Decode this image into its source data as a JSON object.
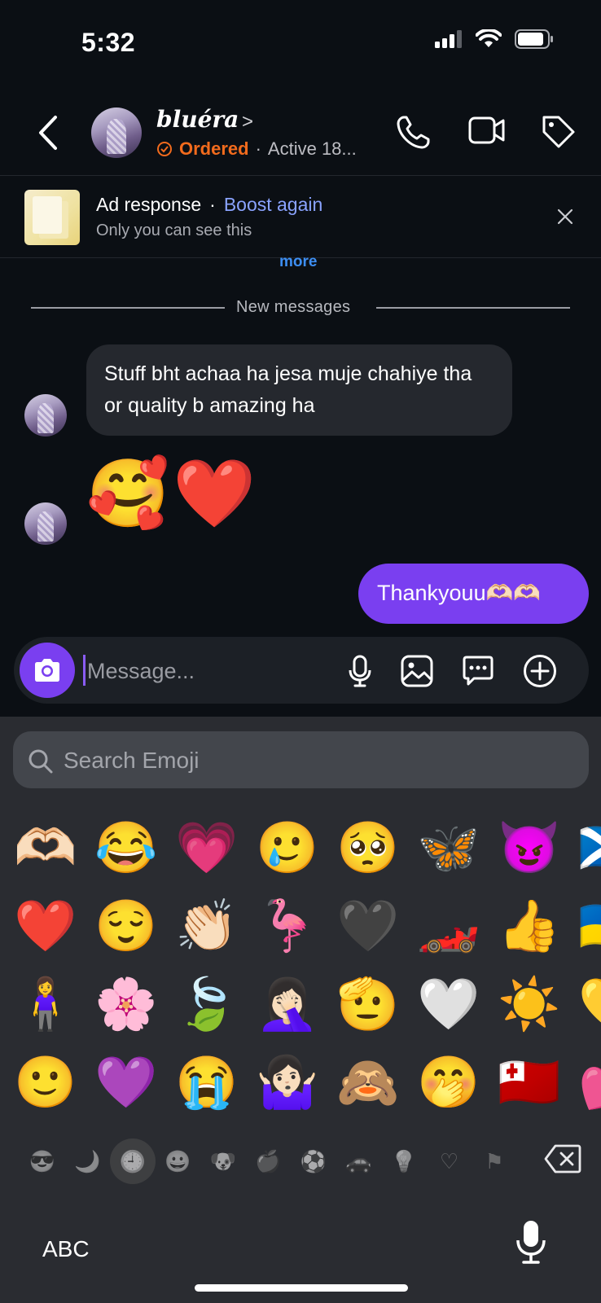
{
  "status_bar": {
    "time": "5:32",
    "icons": [
      "signal-icon",
      "wifi-icon",
      "battery-icon"
    ]
  },
  "header": {
    "contact_name": "bluéra",
    "badge": "Ordered",
    "separator": "·",
    "active_status": "Active 18...",
    "actions": [
      "phone-icon",
      "video-icon",
      "tag-icon"
    ]
  },
  "ad_banner": {
    "title": "Ad response",
    "separator": "·",
    "boost_link": "Boost again",
    "subtitle": "Only you can see this"
  },
  "more_link": "more",
  "new_messages_label": "New messages",
  "messages": [
    {
      "direction": "incoming",
      "type": "text",
      "text": "Stuff bht achaa ha jesa muje chahiye tha or quality b amazing ha"
    },
    {
      "direction": "incoming",
      "type": "emoji",
      "text": "🥰❤️"
    },
    {
      "direction": "outgoing",
      "type": "text",
      "text": "Thankyouu🫶🏻🫶🏻"
    }
  ],
  "composer": {
    "placeholder": "Message...",
    "icons": [
      "camera-icon",
      "microphone-icon",
      "gallery-icon",
      "sticker-icon",
      "plus-icon"
    ]
  },
  "keyboard": {
    "search_placeholder": "Search Emoji",
    "emoji_rows": [
      [
        "🫶🏻",
        "😂",
        "💗",
        "🥲",
        "🥺",
        "🦋",
        "😈",
        "🏴󠁧󠁢󠁳󠁣󠁴󠁿"
      ],
      [
        "❤️",
        "😌",
        "👏🏻",
        "🦩",
        "🖤",
        "🏎️",
        "👍",
        "🇺🇦"
      ],
      [
        "🧍‍♀️",
        "🌸",
        "🍃",
        "🤦🏻‍♀️",
        "🫡",
        "🤍",
        "☀️",
        "💛"
      ],
      [
        "🙂",
        "💜",
        "😭",
        "🤷🏻‍♀️",
        "🙈",
        "🤭",
        "🇹🇴",
        "💕"
      ]
    ],
    "categories": [
      "😎",
      "🌙",
      "🕘",
      "😀",
      "🐶",
      "🍎",
      "⚽",
      "🚗",
      "💡",
      "♡",
      "⚑"
    ],
    "selected_category_index": 2,
    "abc_label": "ABC"
  }
}
